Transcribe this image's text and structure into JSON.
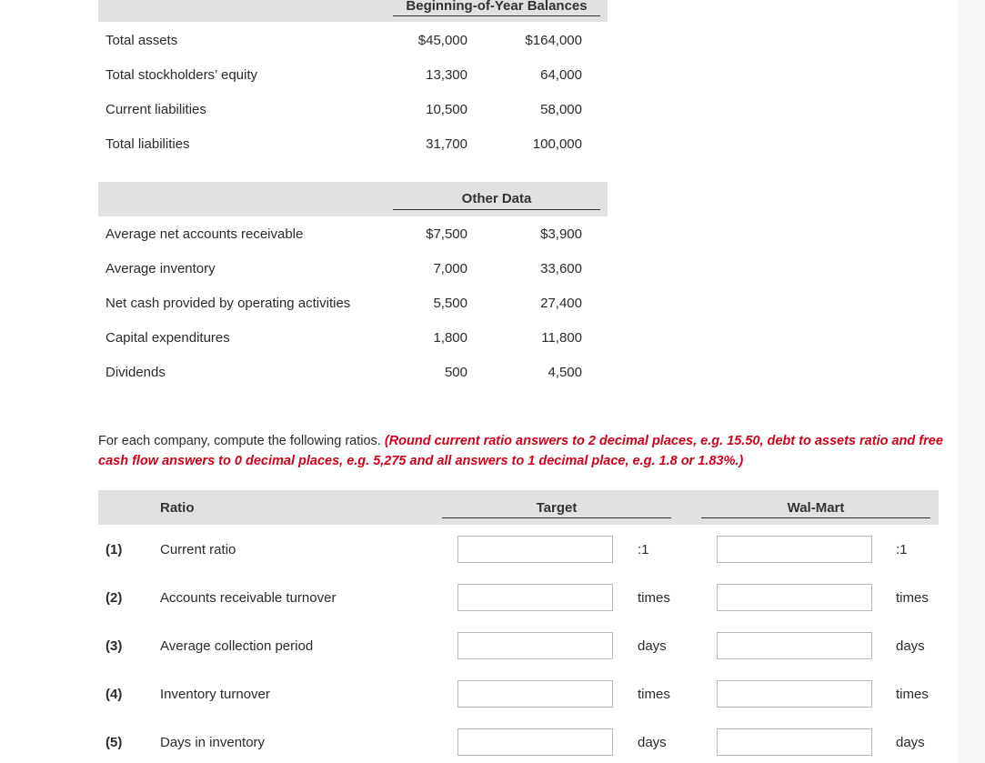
{
  "balances": {
    "header": "Beginning-of-Year Balances",
    "rows": [
      {
        "label": "Total assets",
        "target": "$45,000",
        "walmart": "$164,000"
      },
      {
        "label": "Total stockholders’ equity",
        "target": "13,300",
        "walmart": "64,000"
      },
      {
        "label": "Current liabilities",
        "target": "10,500",
        "walmart": "58,000"
      },
      {
        "label": "Total liabilities",
        "target": "31,700",
        "walmart": "100,000"
      }
    ]
  },
  "other_data": {
    "header": "Other Data",
    "rows": [
      {
        "label": "Average net accounts receivable",
        "target": "$7,500",
        "walmart": "$3,900"
      },
      {
        "label": "Average inventory",
        "target": "7,000",
        "walmart": "33,600"
      },
      {
        "label": "Net cash provided by operating activities",
        "target": "5,500",
        "walmart": "27,400"
      },
      {
        "label": "Capital expenditures",
        "target": "1,800",
        "walmart": "11,800"
      },
      {
        "label": "Dividends",
        "target": "500",
        "walmart": "4,500"
      }
    ]
  },
  "instructions": {
    "plain": "For each company, compute the following ratios. ",
    "emphasis": "(Round current ratio answers to 2 decimal places, e.g. 15.50, debt to assets ratio and free cash flow answers to 0 decimal places, e.g. 5,275 and all answers to 1 decimal place, e.g. 1.8 or 1.83%.)"
  },
  "ratios": {
    "col_ratio": "Ratio",
    "col_target": "Target",
    "col_walmart": "Wal-Mart",
    "rows": [
      {
        "num": "(1)",
        "label": "Current ratio",
        "target_value": "",
        "target_unit": ":1",
        "walmart_value": "",
        "walmart_unit": ":1"
      },
      {
        "num": "(2)",
        "label": "Accounts receivable turnover",
        "target_value": "",
        "target_unit": "times",
        "walmart_value": "",
        "walmart_unit": "times"
      },
      {
        "num": "(3)",
        "label": "Average collection period",
        "target_value": "",
        "target_unit": "days",
        "walmart_value": "",
        "walmart_unit": "days"
      },
      {
        "num": "(4)",
        "label": "Inventory turnover",
        "target_value": "",
        "target_unit": "times",
        "walmart_value": "",
        "walmart_unit": "times"
      },
      {
        "num": "(5)",
        "label": "Days in inventory",
        "target_value": "",
        "target_unit": "days",
        "walmart_value": "",
        "walmart_unit": "days"
      }
    ]
  }
}
